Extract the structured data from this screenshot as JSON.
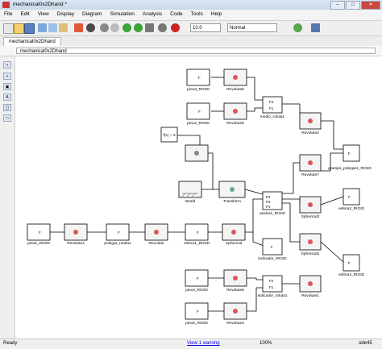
{
  "window": {
    "title": "mechanical0x2Dhand *"
  },
  "menu": [
    "File",
    "Edit",
    "View",
    "Display",
    "Diagram",
    "Simulation",
    "Analysis",
    "Code",
    "Tools",
    "Help"
  ],
  "toolbar": {
    "stop_time": "10.0",
    "mode": "Normal"
  },
  "tab": "mechanical0x2Dhand",
  "address": "mechanical0x2Dhand",
  "blocks": {
    "pinO3": "pino3_RIGID",
    "pinO2": "pino2_RIGID",
    "pinO5": "pino5_RIGID",
    "pinO4": "pino4_RIGID",
    "pinO6": "pino6_RIGID",
    "rev5": "Revolute5",
    "rev6": "Revolute6",
    "rev4": "Revolute4",
    "rev": "Revolute",
    "rev8": "Revolute8",
    "rev3": "Revolute3",
    "rev2": "Revolute2",
    "rev7": "Revolute7",
    "rev1": "Revolute1",
    "medio": "medio_rotula1",
    "polegar": "polegar_rotula1",
    "indicador": "indicador_rotula1",
    "anelar": "anelar2_RIGID",
    "esfera1": "esfera1_RIGID",
    "esfera2": "esfera2_RIGID",
    "esfera3": "esfera3_RIGID",
    "indicador_rigid": "indicador_RIGID",
    "grampo": "grampo_polegar1_RIGID",
    "spherical": "Spherical",
    "spherical2": "Spherical2",
    "spherical1": "Spherical1",
    "world": "World",
    "transform": "Transform",
    "mass": "f(x) = 0"
  },
  "status": {
    "left": "Ready",
    "warning": "View 1 warning",
    "zoom": "100%",
    "solver": "ode45"
  }
}
